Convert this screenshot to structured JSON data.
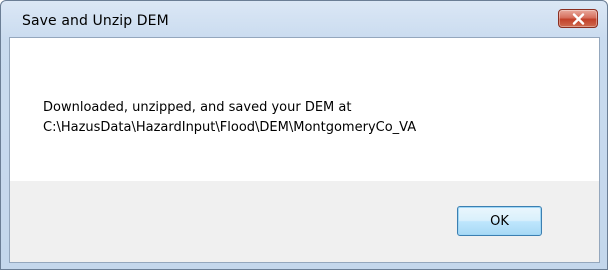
{
  "dialog": {
    "title": "Save and Unzip DEM",
    "message_line1": "Downloaded, unzipped, and saved your DEM at",
    "message_line2": "C:\\HazusData\\HazardInput\\Flood\\DEM\\MontgomeryCo_VA",
    "ok_label": "OK",
    "close_icon": "close-x-icon"
  },
  "colors": {
    "close_button": "#c7432c",
    "ok_button_border": "#3c7fb1",
    "client_background": "#f0f0f0",
    "message_background": "#ffffff"
  }
}
